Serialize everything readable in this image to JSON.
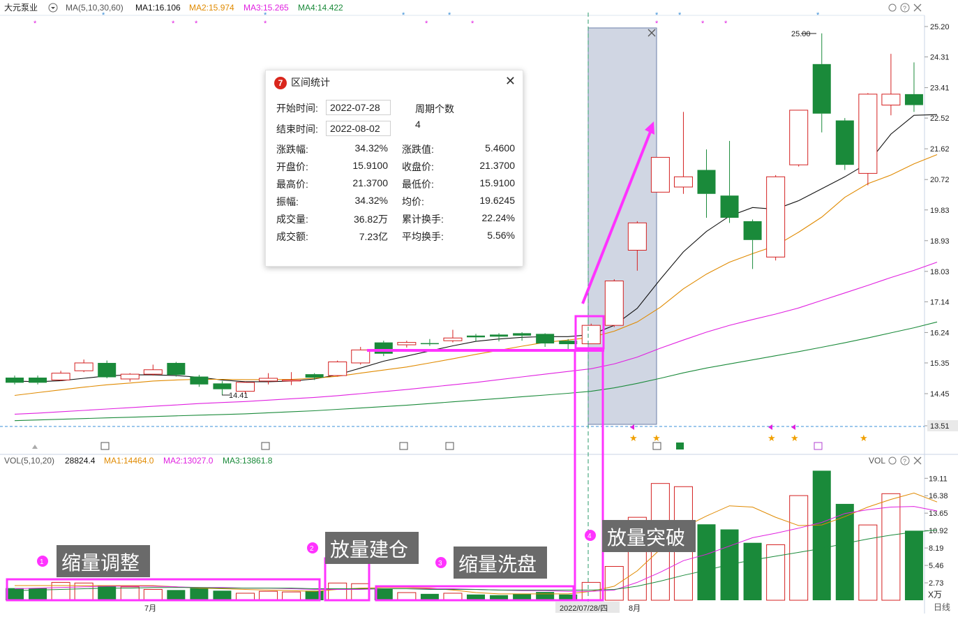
{
  "header": {
    "stock_name": "大元泵业",
    "ma_label": "MA(5,10,30,60)",
    "ma1": "MA1:16.106",
    "ma2": "MA2:15.974",
    "ma3": "MA3:15.265",
    "ma4": "MA4:14.422"
  },
  "vol_header": {
    "label": "VOL(5,10,20)",
    "value": "28824.4",
    "ma1": "MA1:14464.0",
    "ma2": "MA2:13027.0",
    "ma3": "MA3:13861.8",
    "right_label": "VOL",
    "unit": "X万",
    "period": "日线"
  },
  "colors": {
    "up": "#d42020",
    "down": "#1a8a3a",
    "ma1": "#111111",
    "ma2": "#e08a00",
    "ma3": "#e020e0",
    "ma4": "#1a8a3a",
    "highlight": "#ff33ff",
    "selection": "#a9b4cc"
  },
  "annotations": {
    "high_label": "25.00",
    "low_label": "14.41",
    "x_month1": "7月",
    "x_month2": "8月",
    "x_cursor": "2022/07/28/四",
    "notes": [
      {
        "num": "1",
        "text": "缩量调整"
      },
      {
        "num": "2",
        "text": "放量建仓"
      },
      {
        "num": "3",
        "text": "缩量洗盘"
      },
      {
        "num": "4",
        "text": "放量突破"
      }
    ]
  },
  "stats_box": {
    "title": "区间统计",
    "start_label": "开始时间:",
    "start_value": "2022-07-28",
    "end_label": "结束时间:",
    "end_value": "2022-08-02",
    "count_label": "周期个数",
    "count_value": "4",
    "rows": [
      [
        "涨跌幅:",
        "34.32%",
        "涨跌值:",
        "5.4600"
      ],
      [
        "开盘价:",
        "15.9100",
        "收盘价:",
        "21.3700"
      ],
      [
        "最高价:",
        "21.3700",
        "最低价:",
        "15.9100"
      ],
      [
        "振幅:",
        "34.32%",
        "均价:",
        "19.6245"
      ],
      [
        "成交量:",
        "36.82万",
        "累计换手:",
        "22.24%"
      ],
      [
        "成交额:",
        "7.23亿",
        "平均换手:",
        "5.56%"
      ]
    ]
  },
  "chart_data": {
    "type": "candlestick",
    "price_axis": {
      "ticks": [
        25.2,
        24.31,
        23.41,
        22.52,
        21.62,
        20.72,
        19.83,
        18.93,
        18.03,
        17.14,
        16.24,
        15.35,
        14.45,
        13.51
      ],
      "range": [
        13.51,
        25.2
      ]
    },
    "volume_axis": {
      "ticks": [
        19.11,
        16.38,
        13.65,
        10.92,
        8.19,
        5.46,
        2.73
      ],
      "range": [
        0,
        21.0
      ]
    },
    "candles": [
      {
        "o": 14.92,
        "h": 14.98,
        "l": 14.72,
        "c": 14.77,
        "v": 1.9
      },
      {
        "o": 14.92,
        "h": 14.98,
        "l": 14.72,
        "c": 14.77,
        "v": 1.9
      },
      {
        "o": 14.85,
        "h": 15.12,
        "l": 14.82,
        "c": 15.05,
        "v": 2.8
      },
      {
        "o": 15.12,
        "h": 15.45,
        "l": 15.08,
        "c": 15.35,
        "v": 2.7
      },
      {
        "o": 15.35,
        "h": 15.42,
        "l": 14.9,
        "c": 14.93,
        "v": 2.3
      },
      {
        "o": 14.88,
        "h": 15.05,
        "l": 14.8,
        "c": 15.02,
        "v": 2.1
      },
      {
        "o": 15.02,
        "h": 15.3,
        "l": 14.98,
        "c": 15.15,
        "v": 1.7
      },
      {
        "o": 15.35,
        "h": 15.38,
        "l": 14.95,
        "c": 15.0,
        "v": 1.6
      },
      {
        "o": 14.95,
        "h": 15.0,
        "l": 14.65,
        "c": 14.72,
        "v": 1.9
      },
      {
        "o": 14.75,
        "h": 14.82,
        "l": 14.41,
        "c": 14.58,
        "v": 1.5
      },
      {
        "o": 14.52,
        "h": 14.8,
        "l": 14.45,
        "c": 14.78,
        "v": 1.1
      },
      {
        "o": 14.82,
        "h": 15.05,
        "l": 14.72,
        "c": 14.9,
        "v": 1.4
      },
      {
        "o": 14.85,
        "h": 15.08,
        "l": 14.7,
        "c": 14.85,
        "v": 1.3
      },
      {
        "o": 15.02,
        "h": 15.05,
        "l": 14.85,
        "c": 14.92,
        "v": 1.5
      },
      {
        "o": 14.98,
        "h": 15.42,
        "l": 14.95,
        "c": 15.38,
        "v": 2.7
      },
      {
        "o": 15.35,
        "h": 15.82,
        "l": 15.3,
        "c": 15.73,
        "v": 2.6
      },
      {
        "o": 15.95,
        "h": 16.0,
        "l": 15.55,
        "c": 15.62,
        "v": 1.8
      },
      {
        "o": 15.88,
        "h": 16.0,
        "l": 15.8,
        "c": 15.95,
        "v": 1.2
      },
      {
        "o": 15.93,
        "h": 16.05,
        "l": 15.85,
        "c": 15.9,
        "v": 1.0
      },
      {
        "o": 16.0,
        "h": 16.32,
        "l": 15.95,
        "c": 16.08,
        "v": 1.1
      },
      {
        "o": 16.15,
        "h": 16.2,
        "l": 15.98,
        "c": 16.1,
        "v": 0.9
      },
      {
        "o": 16.18,
        "h": 16.22,
        "l": 15.98,
        "c": 16.12,
        "v": 0.8
      },
      {
        "o": 16.22,
        "h": 16.25,
        "l": 16.0,
        "c": 16.15,
        "v": 1.0
      },
      {
        "o": 16.2,
        "h": 16.22,
        "l": 15.82,
        "c": 15.92,
        "v": 1.3
      },
      {
        "o": 16.0,
        "h": 16.05,
        "l": 15.7,
        "c": 15.9,
        "v": 0.9
      },
      {
        "o": 15.91,
        "h": 16.5,
        "l": 15.91,
        "c": 16.45,
        "v": 2.8
      },
      {
        "o": 16.45,
        "h": 17.8,
        "l": 16.4,
        "c": 17.75,
        "v": 5.3
      },
      {
        "o": 18.65,
        "h": 19.5,
        "l": 18.05,
        "c": 19.45,
        "v": 13.0
      },
      {
        "o": 20.35,
        "h": 21.37,
        "l": 20.35,
        "c": 21.37,
        "v": 18.3
      },
      {
        "o": 20.5,
        "h": 22.7,
        "l": 20.3,
        "c": 20.8,
        "v": 17.8
      },
      {
        "o": 21.0,
        "h": 21.6,
        "l": 19.6,
        "c": 20.3,
        "v": 11.9
      },
      {
        "o": 20.25,
        "h": 21.85,
        "l": 19.45,
        "c": 19.6,
        "v": 11.1
      },
      {
        "o": 19.5,
        "h": 19.55,
        "l": 18.1,
        "c": 18.95,
        "v": 9.0
      },
      {
        "o": 18.45,
        "h": 20.85,
        "l": 18.35,
        "c": 20.8,
        "v": 8.7
      },
      {
        "o": 21.15,
        "h": 22.75,
        "l": 21.1,
        "c": 22.75,
        "v": 16.4
      },
      {
        "o": 24.1,
        "h": 25.0,
        "l": 22.1,
        "c": 22.65,
        "v": 20.3
      },
      {
        "o": 22.45,
        "h": 22.52,
        "l": 21.0,
        "c": 21.15,
        "v": 15.1
      },
      {
        "o": 20.9,
        "h": 23.25,
        "l": 20.55,
        "c": 23.22,
        "v": 11.8
      },
      {
        "o": 22.9,
        "h": 24.4,
        "l": 22.6,
        "c": 23.22,
        "v": 16.7
      },
      {
        "o": 23.22,
        "h": 24.15,
        "l": 22.7,
        "c": 22.9,
        "v": 10.9
      }
    ],
    "ma_series": [
      {
        "name": "MA1",
        "values": [
          14.82,
          14.8,
          14.83,
          14.9,
          14.97,
          15.0,
          15.0,
          14.98,
          14.93,
          14.85,
          14.8,
          14.8,
          14.82,
          14.88,
          15.0,
          15.2,
          15.4,
          15.55,
          15.7,
          15.85,
          15.98,
          16.05,
          16.1,
          16.12,
          16.12,
          16.18,
          16.45,
          16.95,
          17.8,
          18.6,
          19.2,
          19.65,
          19.9,
          19.85,
          20.1,
          20.45,
          20.8,
          21.2,
          22.05,
          22.6,
          22.62
        ]
      },
      {
        "name": "MA2",
        "values": [
          14.4,
          14.48,
          14.56,
          14.64,
          14.71,
          14.76,
          14.82,
          14.85,
          14.87,
          14.87,
          14.86,
          14.86,
          14.87,
          14.9,
          14.96,
          15.05,
          15.14,
          15.23,
          15.35,
          15.47,
          15.6,
          15.72,
          15.84,
          15.95,
          16.02,
          16.1,
          16.28,
          16.55,
          16.98,
          17.52,
          17.95,
          18.3,
          18.55,
          18.78,
          19.18,
          19.62,
          20.2,
          20.6,
          20.85,
          21.18,
          21.45
        ]
      },
      {
        "name": "MA3",
        "values": [
          13.85,
          13.88,
          13.92,
          13.96,
          14.0,
          14.04,
          14.08,
          14.12,
          14.16,
          14.19,
          14.22,
          14.26,
          14.3,
          14.34,
          14.39,
          14.45,
          14.51,
          14.57,
          14.64,
          14.71,
          14.78,
          14.86,
          14.94,
          15.02,
          15.1,
          15.18,
          15.32,
          15.52,
          15.78,
          16.02,
          16.25,
          16.45,
          16.62,
          16.78,
          16.96,
          17.18,
          17.4,
          17.62,
          17.85,
          18.06,
          18.3
        ]
      },
      {
        "name": "MA4",
        "values": [
          13.66,
          13.68,
          13.7,
          13.72,
          13.74,
          13.76,
          13.78,
          13.8,
          13.82,
          13.84,
          13.86,
          13.89,
          13.92,
          13.95,
          13.99,
          14.03,
          14.07,
          14.11,
          14.16,
          14.21,
          14.26,
          14.31,
          14.36,
          14.41,
          14.46,
          14.52,
          14.62,
          14.75,
          14.9,
          15.06,
          15.2,
          15.32,
          15.44,
          15.56,
          15.68,
          15.81,
          15.94,
          16.08,
          16.23,
          16.38,
          16.55
        ]
      }
    ],
    "vol_ma_series": [
      {
        "name": "MA1",
        "values": [
          2.3,
          2.3,
          2.3,
          2.3,
          2.3,
          2.3,
          2.3,
          2.1,
          1.9,
          1.8,
          1.7,
          1.6,
          1.5,
          1.4,
          1.7,
          1.9,
          2.0,
          2.0,
          1.9,
          1.6,
          1.2,
          1.0,
          1.0,
          1.0,
          1.0,
          1.4,
          2.2,
          4.6,
          8.0,
          11.4,
          13.2,
          14.8,
          14.6,
          13.0,
          11.7,
          11.8,
          13.1,
          14.6,
          15.8,
          16.8,
          15.4
        ]
      },
      {
        "name": "MA2",
        "values": [
          1.8,
          1.9,
          2.0,
          2.1,
          2.2,
          2.2,
          2.2,
          2.1,
          2.0,
          2.0,
          1.9,
          1.9,
          1.8,
          1.7,
          1.7,
          1.7,
          1.8,
          1.8,
          1.8,
          1.8,
          1.7,
          1.6,
          1.5,
          1.5,
          1.4,
          1.4,
          1.6,
          2.8,
          4.4,
          6.2,
          7.2,
          8.5,
          9.8,
          10.5,
          11.3,
          12.2,
          13.6,
          14.2,
          14.6,
          14.7,
          14.0
        ]
      },
      {
        "name": "MA3",
        "values": [
          1.5,
          1.6,
          1.7,
          1.8,
          1.9,
          1.9,
          2.0,
          2.0,
          2.0,
          1.9,
          1.9,
          1.9,
          1.9,
          1.8,
          1.8,
          1.8,
          1.8,
          1.8,
          1.7,
          1.7,
          1.7,
          1.6,
          1.6,
          1.6,
          1.6,
          1.6,
          1.7,
          2.2,
          3.0,
          3.9,
          4.7,
          5.6,
          6.3,
          6.9,
          7.5,
          8.1,
          8.9,
          9.6,
          10.2,
          10.7,
          11.0
        ]
      }
    ]
  }
}
